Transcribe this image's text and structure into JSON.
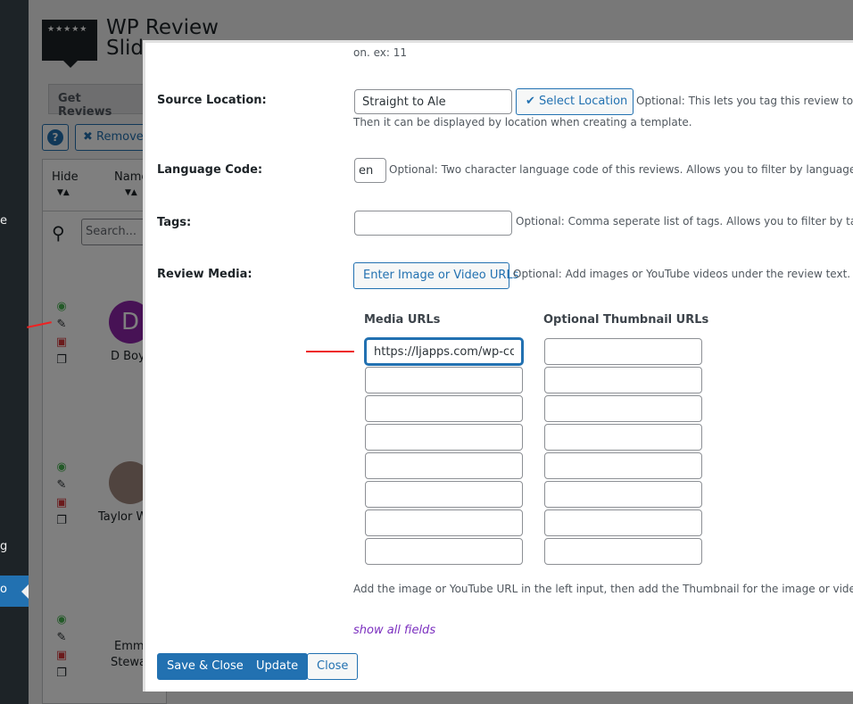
{
  "background": {
    "sidebar": {
      "items": [
        "e",
        "g",
        "o"
      ]
    },
    "title_line1": "WP Review",
    "title_line2": "Slid",
    "logo_stars": "★★★★★",
    "tab": "Get Reviews",
    "help_icon_text": "?",
    "remove_button": "Remove",
    "table": {
      "headers": [
        "Hide",
        "Name"
      ],
      "sort_glyph": "▼▲",
      "search_placeholder": "Search..."
    },
    "rows": [
      {
        "name": "D Boy",
        "initial": "D"
      },
      {
        "name": "Taylor W"
      },
      {
        "name_line1": "Emma",
        "name_line2": "Stewa"
      }
    ]
  },
  "modal": {
    "top_text": "on. ex: 11",
    "source_location": {
      "label": "Source Location:",
      "value": "Straight to Ale",
      "button": "Select Location",
      "desc": "Optional: This lets you tag this review to a",
      "desc2": "Then it can be displayed by location when creating a template."
    },
    "language_code": {
      "label": "Language Code:",
      "value": "en",
      "desc": "Optional: Two character language code of this reviews. Allows you to filter by language on"
    },
    "tags": {
      "label": "Tags:",
      "value": "",
      "desc": "Optional: Comma seperate list of tags. Allows you to filter by tag i"
    },
    "review_media": {
      "label": "Review Media:",
      "button": "Enter Image or Video URLs",
      "desc": "Optional: Add images or YouTube videos under the review text."
    },
    "media_table": {
      "col1": "Media URLs",
      "col2": "Optional Thumbnail URLs",
      "media_urls": [
        "https://ljapps.com/wp-con",
        "",
        "",
        "",
        "",
        "",
        "",
        ""
      ],
      "thumbnail_urls": [
        "",
        "",
        "",
        "",
        "",
        "",
        "",
        ""
      ]
    },
    "help_text": "Add the image or YouTube URL in the left input, then add the Thumbnail for the image or video or",
    "show_all": "show all fields",
    "buttons": {
      "save_close": "Save & Close",
      "update": "Update",
      "close": "Close"
    }
  },
  "colors": {
    "primary": "#2271b1",
    "link_purple": "#7b2fbf",
    "annotation_red": "#e22222"
  }
}
